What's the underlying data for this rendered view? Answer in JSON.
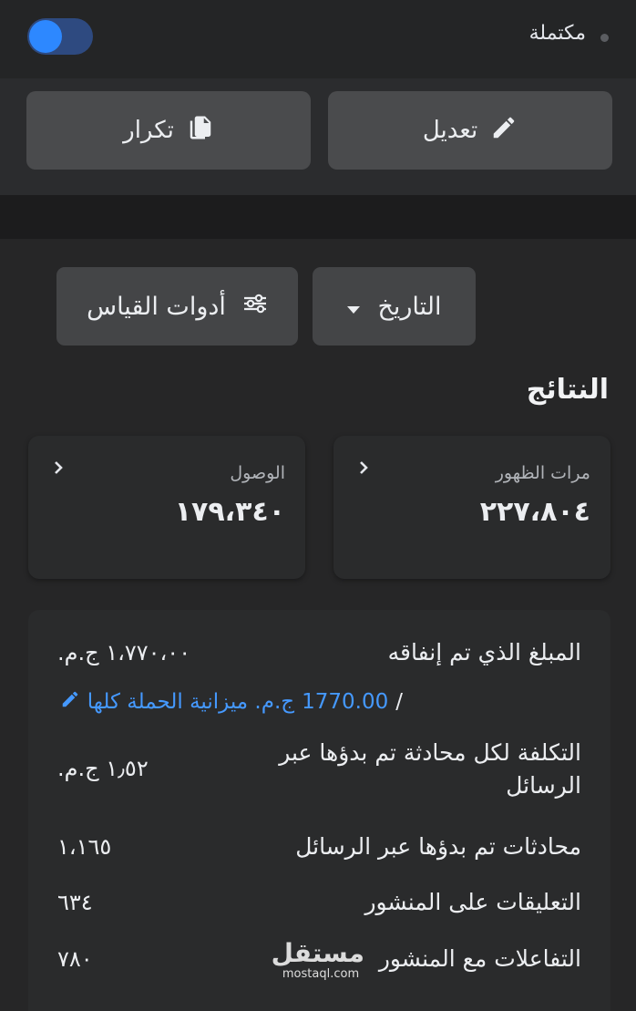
{
  "header": {
    "status_label": "مكتملة",
    "toggle_on": true
  },
  "actions": {
    "edit_label": "تعديل",
    "duplicate_label": "تكرار"
  },
  "filters": {
    "date_label": "التاريخ",
    "metrics_label": "أدوات القياس"
  },
  "results": {
    "title": "النتائج",
    "impressions": {
      "label": "مرات الظهور",
      "value": "٢٢٧،٨٠٤"
    },
    "reach": {
      "label": "الوصول",
      "value": "١٧٩،٣٤٠"
    }
  },
  "details": {
    "amount_spent": {
      "label": "المبلغ الذي تم إنفاقه",
      "value": "١،٧٧٠،٠٠ ج.م."
    },
    "budget": {
      "slash": "/",
      "amount": "1770.00",
      "text": "ج.م. ميزانية الحملة كلها"
    },
    "cost_per_conversation": {
      "label_line1": "التكلفة لكل محادثة تم بدؤها عبر",
      "label_line2": "الرسائل",
      "value": "١٫٥٢ ج.م."
    },
    "conversations": {
      "label": "محادثات تم بدؤها عبر الرسائل",
      "value": "١،١٦٥"
    },
    "comments": {
      "label": "التعليقات على المنشور",
      "value": "٦٣٤"
    },
    "engagements": {
      "label": "التفاعلات مع المنشور",
      "value": "٧٨٠"
    }
  },
  "watermark": {
    "arabic": "مستقل",
    "latin": "mostaql.com"
  },
  "colors": {
    "accent": "#2d88ff",
    "link": "#4599ff",
    "background": "#262627"
  },
  "icons": [
    "pencil-icon",
    "copy-icon",
    "caret-down-icon",
    "sliders-icon",
    "chevron-right-icon"
  ]
}
